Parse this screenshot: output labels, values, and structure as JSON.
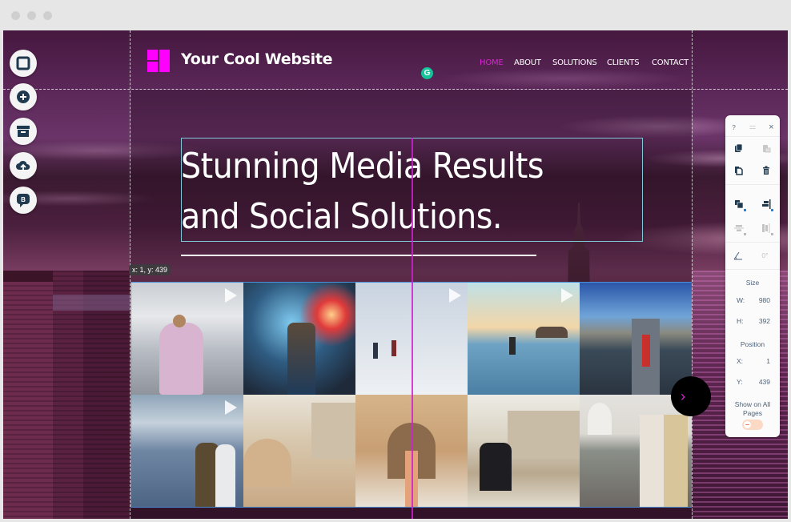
{
  "window": {
    "controls": [
      "close",
      "minimize",
      "maximize"
    ]
  },
  "site": {
    "title": "Your Cool Website",
    "logo_color": "#ff00ff",
    "nav": [
      {
        "label": "HOME",
        "active": true
      },
      {
        "label": "ABOUT",
        "active": false
      },
      {
        "label": "SOLUTIONS",
        "active": false
      },
      {
        "label": "CLIENTS",
        "active": false
      },
      {
        "label": "CONTACT",
        "active": false
      }
    ],
    "nav_active_color": "#e020d8",
    "headline_line1": "Stunning Media Results",
    "headline_line2": "and Social Solutions."
  },
  "editor": {
    "coord_tooltip": "x: 1, y: 439",
    "grammarly_icon": "G",
    "left_toolbar": [
      {
        "name": "pages-icon"
      },
      {
        "name": "add-icon"
      },
      {
        "name": "store-icon"
      },
      {
        "name": "upload-icon"
      },
      {
        "name": "blog-icon",
        "label": "B"
      }
    ],
    "next_arrow": "›"
  },
  "gallery": {
    "tiles": [
      {
        "subject": "woman in pink fur coat in snowy mountains",
        "video": true
      },
      {
        "subject": "woman with red flare in ice cave",
        "video": false
      },
      {
        "subject": "hikers in snow",
        "video": true
      },
      {
        "subject": "surfer at beach",
        "video": true
      },
      {
        "subject": "woman by coastal rocks",
        "video": false
      },
      {
        "subject": "couple overlooking mountains",
        "video": true
      },
      {
        "subject": "woman on dome rooftop",
        "video": false
      },
      {
        "subject": "woman at ornate palace gate",
        "video": false
      },
      {
        "subject": "couple on terrace with palace",
        "video": false
      },
      {
        "subject": "couple at Taj Mahal",
        "video": false
      }
    ]
  },
  "panel": {
    "help": "?",
    "drag": "::::",
    "close": "×",
    "size_label": "Size",
    "width_label": "W:",
    "width_value": "980",
    "height_label": "H:",
    "height_value": "392",
    "position_label": "Position",
    "x_label": "X:",
    "x_value": "1",
    "y_label": "Y:",
    "y_value": "439",
    "rotation_value": "0°",
    "show_all_pages_label": "Show on All Pages",
    "show_all_pages_on": false
  }
}
